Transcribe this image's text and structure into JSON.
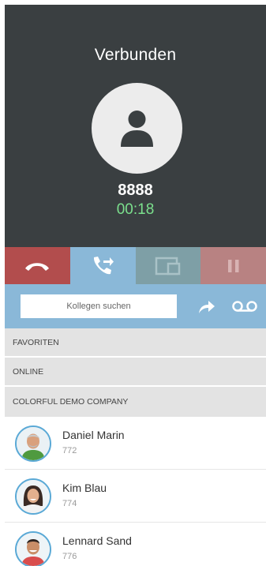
{
  "call": {
    "status": "Verbunden",
    "number": "8888",
    "timer": "00:18"
  },
  "actions": [
    {
      "name": "hangup",
      "icon": "hangup-phone-icon",
      "color": "#b24d4d"
    },
    {
      "name": "transfer",
      "icon": "transfer-call-icon",
      "color": "#8ab8d8",
      "active": true
    },
    {
      "name": "screen",
      "icon": "screen-devices-icon",
      "color": "#7e9fa6"
    },
    {
      "name": "hold",
      "icon": "pause-icon",
      "color": "#b88282"
    }
  ],
  "transfer": {
    "search_placeholder": "Kollegen suchen",
    "forward_icon": "forward-arrow-icon",
    "voicemail_icon": "voicemail-icon"
  },
  "sections": {
    "favorites": "FAVORITEN",
    "online": "ONLINE",
    "company": "COLORFUL DEMO COMPANY"
  },
  "contacts": [
    {
      "name": "Daniel Marin",
      "extension": "772"
    },
    {
      "name": "Kim Blau",
      "extension": "774"
    },
    {
      "name": "Lennard Sand",
      "extension": "776"
    }
  ],
  "colors": {
    "panel": "#3a3f41",
    "timer": "#7be08d",
    "accent": "#8ab8d8",
    "section": "#e3e3e3"
  }
}
